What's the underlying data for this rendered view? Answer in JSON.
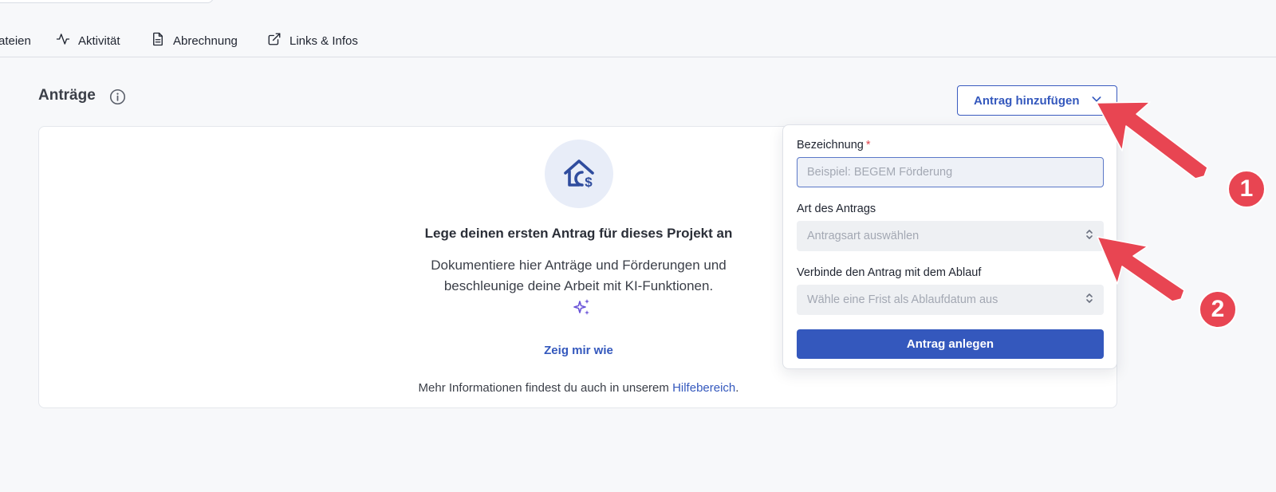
{
  "tabs": [
    {
      "label": "ateien",
      "icon": "files-icon"
    },
    {
      "label": "Aktivität",
      "icon": "activity-icon"
    },
    {
      "label": "Abrechnung",
      "icon": "document-icon"
    },
    {
      "label": "Links & Infos",
      "icon": "external-link-icon"
    }
  ],
  "section": {
    "title": "Anträge",
    "add_button_label": "Antrag hinzufügen"
  },
  "empty_state": {
    "heading": "Lege deinen ersten Antrag für dieses Projekt an",
    "description_line1": "Dokumentiere hier Anträge und Förderungen und",
    "description_line2": "beschleunige deine Arbeit mit KI-Funktionen.",
    "show_me_link": "Zeig mir wie",
    "footer_prefix": "Mehr Informationen findest du auch in unserem ",
    "footer_link": "Hilfebereich",
    "footer_suffix": "."
  },
  "form": {
    "name_label": "Bezeichnung",
    "required_marker": "*",
    "name_placeholder": "Beispiel: BEGEM Förderung",
    "type_label": "Art des Antrags",
    "type_placeholder": "Antragsart auswählen",
    "deadline_label": "Verbinde den Antrag mit dem Ablauf",
    "deadline_placeholder": "Wähle eine Frist als Ablaufdatum aus",
    "submit_label": "Antrag anlegen"
  },
  "annotations": {
    "badge_1": "1",
    "badge_2": "2"
  },
  "colors": {
    "accent": "#3458bd",
    "annotation_red": "#e84552",
    "required_red": "#e0454d"
  }
}
